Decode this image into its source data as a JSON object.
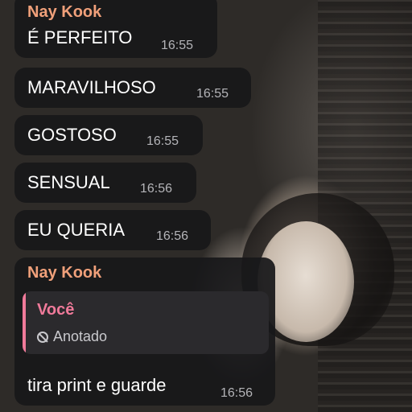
{
  "chat": {
    "first_group": {
      "sender": "Nay Kook",
      "messages": [
        {
          "text": "É PERFEITO",
          "time": "16:55"
        },
        {
          "text": "MARAVILHOSO",
          "time": "16:55"
        },
        {
          "text": "GOSTOSO",
          "time": "16:55"
        },
        {
          "text": "SENSUAL",
          "time": "16:56"
        },
        {
          "text": "EU QUERIA",
          "time": "16:56"
        }
      ]
    },
    "reply_message": {
      "sender": "Nay Kook",
      "quoted_author": "Você",
      "quoted_status": "Anotado",
      "quoted_status_icon": "ban-icon",
      "text": "tira print e guarde",
      "time": "16:56"
    }
  },
  "colors": {
    "sender_name": "#f0a07a",
    "quoted_author": "#f07a9a",
    "bubble_bg": "#18181a"
  }
}
